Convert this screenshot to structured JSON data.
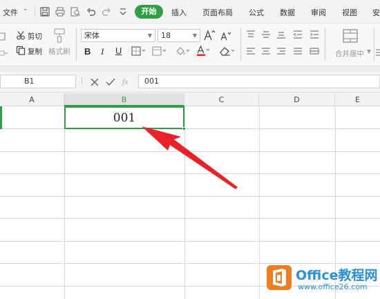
{
  "menu": {
    "file": "文件",
    "tabs": [
      "开始",
      "插入",
      "页面布局",
      "公式",
      "数据",
      "审阅",
      "视图",
      "安"
    ]
  },
  "ribbon": {
    "cut": "剪切",
    "copy": "复制",
    "format_painter": "格式刷",
    "font_name": "宋体",
    "font_size": "18",
    "merge_center": "合并居中"
  },
  "formula_bar": {
    "name_box": "B1",
    "fx": "fx",
    "value": "001"
  },
  "sheet": {
    "columns": [
      "A",
      "B",
      "C",
      "D",
      "E"
    ],
    "selected_column": "B",
    "cell_b1": "001"
  },
  "watermark": {
    "title": "Office教程网",
    "url": "www.office26.com"
  },
  "colors": {
    "accent_green": "#2f9e44",
    "annotation_red": "#e8212b",
    "watermark_blue": "#2b8fd9",
    "watermark_orange": "#f07d21"
  }
}
